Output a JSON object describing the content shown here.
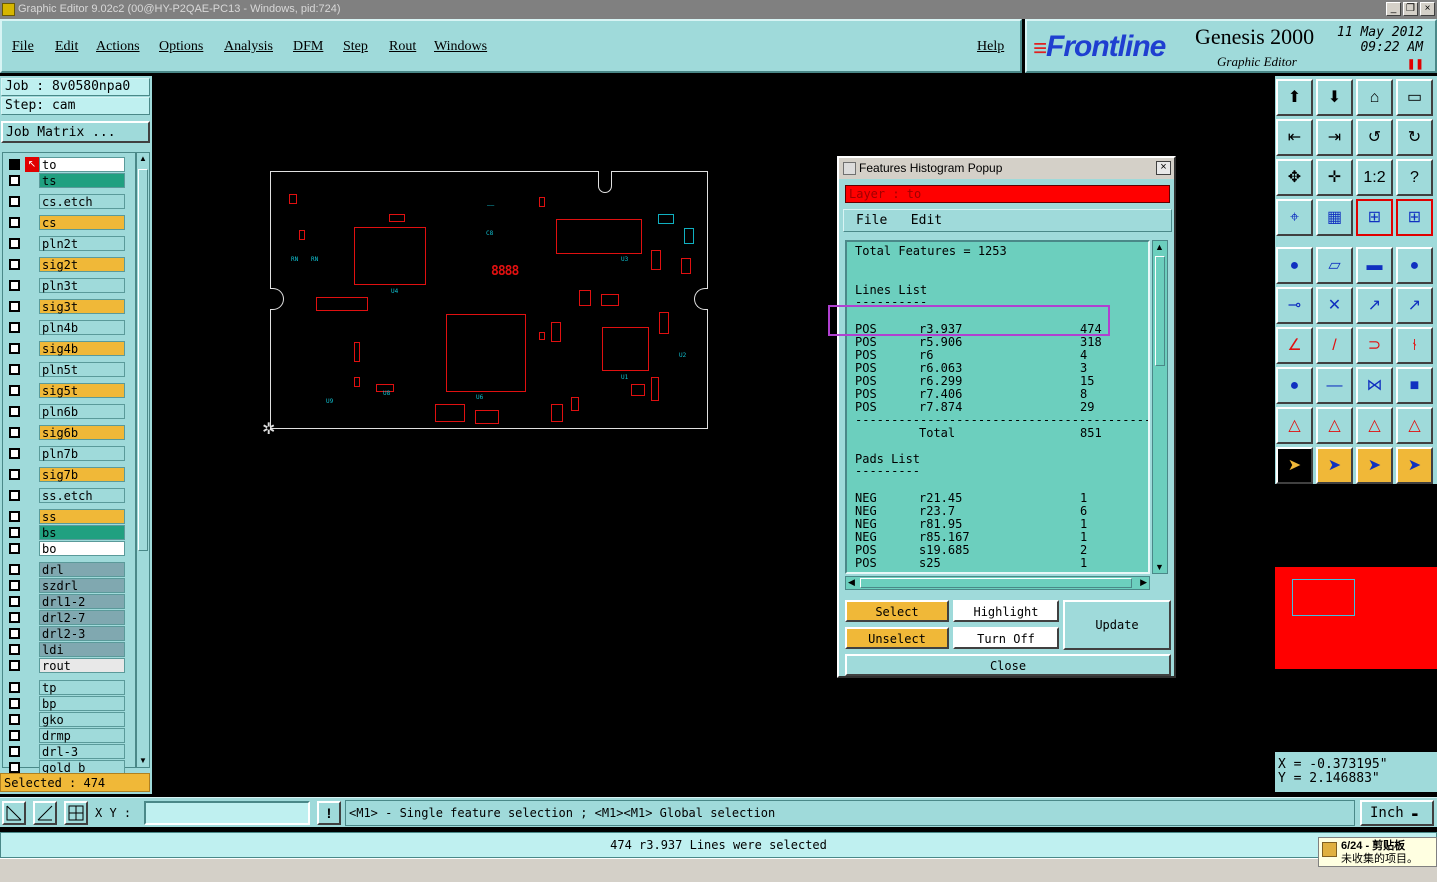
{
  "window": {
    "title": "Graphic Editor 9.02c2 (00@HY-P2QAE-PC13 - Windows, pid:724)"
  },
  "menu": [
    "File",
    "Edit",
    "Actions",
    "Options",
    "Analysis",
    "DFM",
    "Step",
    "Rout",
    "Windows"
  ],
  "help": "Help",
  "brand": {
    "logo_a": "Front",
    "logo_b": "line",
    "product": "Genesis 2000",
    "subtitle": "Graphic Editor",
    "date_line1": "11 May 2012",
    "date_line2": "09:22 AM"
  },
  "job": {
    "job_label": "Job : 8v0580npa0",
    "step_label": "Step: cam",
    "matrix_button": "Job Matrix ..."
  },
  "layers": [
    {
      "name": "to",
      "color": "#ffffff"
    },
    {
      "name": "ts",
      "color": "#20a080"
    },
    {
      "name": "cs.etch",
      "color": "#9fdada"
    },
    {
      "name": "cs",
      "color": "#f0b838"
    },
    {
      "name": "pln2t",
      "color": "#9fdada"
    },
    {
      "name": "sig2t",
      "color": "#f0b838"
    },
    {
      "name": "pln3t",
      "color": "#9fdada"
    },
    {
      "name": "sig3t",
      "color": "#f0b838"
    },
    {
      "name": "pln4b",
      "color": "#9fdada"
    },
    {
      "name": "sig4b",
      "color": "#f0b838"
    },
    {
      "name": "pln5t",
      "color": "#9fdada"
    },
    {
      "name": "sig5t",
      "color": "#f0b838"
    },
    {
      "name": "pln6b",
      "color": "#9fdada"
    },
    {
      "name": "sig6b",
      "color": "#f0b838"
    },
    {
      "name": "pln7b",
      "color": "#9fdada"
    },
    {
      "name": "sig7b",
      "color": "#f0b838"
    },
    {
      "name": "ss.etch",
      "color": "#9fdada"
    },
    {
      "name": "ss",
      "color": "#f0b838"
    },
    {
      "name": "bs",
      "color": "#20a080"
    },
    {
      "name": "bo",
      "color": "#ffffff"
    },
    {
      "name": "drl",
      "color": "#80a8b0"
    },
    {
      "name": "szdrl",
      "color": "#80a8b0"
    },
    {
      "name": "drl1-2",
      "color": "#80a8b0"
    },
    {
      "name": "drl2-7",
      "color": "#80a8b0"
    },
    {
      "name": "drl2-3",
      "color": "#80a8b0"
    },
    {
      "name": "ldi",
      "color": "#80a8b0"
    },
    {
      "name": "rout",
      "color": "#e8e8e8"
    },
    {
      "name": "tp",
      "color": "#9fdada"
    },
    {
      "name": "bp",
      "color": "#9fdada"
    },
    {
      "name": "gko",
      "color": "#9fdada"
    },
    {
      "name": "drmp",
      "color": "#9fdada"
    },
    {
      "name": "drl-3",
      "color": "#9fdada"
    },
    {
      "name": "gold_b",
      "color": "#9fdada"
    }
  ],
  "selected": "Selected : 474",
  "popup": {
    "title": "Features Histogram Popup",
    "layer": "Layer :  to",
    "menu": [
      "File",
      "Edit"
    ],
    "total": "Total Features = 1253",
    "lines_header": "Lines List",
    "lines_rule": "----------",
    "lines": [
      {
        "pol": "POS",
        "sym": "r3.937",
        "count": "474"
      },
      {
        "pol": "POS",
        "sym": "r5.906",
        "count": "318"
      },
      {
        "pol": "POS",
        "sym": "r6",
        "count": "4"
      },
      {
        "pol": "POS",
        "sym": "r6.063",
        "count": "3"
      },
      {
        "pol": "POS",
        "sym": "r6.299",
        "count": "15"
      },
      {
        "pol": "POS",
        "sym": "r7.406",
        "count": "8"
      },
      {
        "pol": "POS",
        "sym": "r7.874",
        "count": "29"
      }
    ],
    "long_rule": "---------------------------------------------",
    "total_label": "Total",
    "total_value": "851",
    "pads_header": "Pads List",
    "pads_rule": "---------",
    "pads": [
      {
        "pol": "NEG",
        "sym": "r21.45",
        "count": "1"
      },
      {
        "pol": "NEG",
        "sym": "r23.7",
        "count": "6"
      },
      {
        "pol": "NEG",
        "sym": "r81.95",
        "count": "1"
      },
      {
        "pol": "NEG",
        "sym": "r85.167",
        "count": "1"
      },
      {
        "pol": "POS",
        "sym": "s19.685",
        "count": "2"
      },
      {
        "pol": "POS",
        "sym": "s25",
        "count": "1"
      }
    ],
    "buttons": {
      "select": "Select",
      "highlight": "Highlight",
      "update": "Update",
      "unselect": "Unselect",
      "turn_off": "Turn Off",
      "close": "Close"
    }
  },
  "coords": {
    "x": "X = -0.373195\"",
    "y": "Y = 2.146883\""
  },
  "status": {
    "xy_label": "X Y :",
    "hint": "<M1> - Single feature selection ; <M1><M1> Global selection",
    "units": "Inch"
  },
  "message": "474 r3.937 Lines were selected",
  "tray": {
    "line1": "6/24 - 剪贴板",
    "line2": "未收集的项目。"
  }
}
